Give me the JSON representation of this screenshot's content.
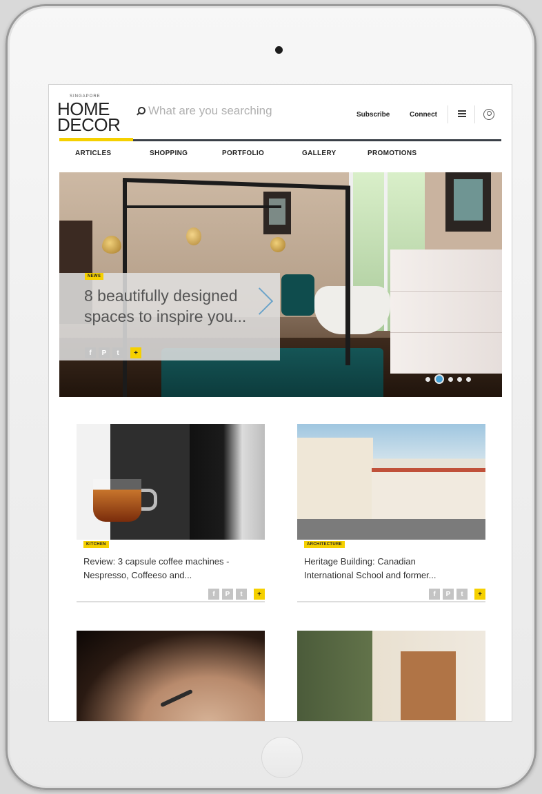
{
  "brand": {
    "logo_small": "SINGAPORE",
    "logo_line1": "HOME",
    "logo_line2": "DECOR"
  },
  "search": {
    "placeholder": "What are you searching"
  },
  "header": {
    "subscribe": "Subscribe",
    "connect": "Connect"
  },
  "nav": [
    "ARTICLES",
    "SHOPPING",
    "PORTFOLIO",
    "GALLERY",
    "PROMOTIONS"
  ],
  "hero": {
    "tag": "NEWS",
    "title_line1": "8 beautifully designed",
    "title_line2": "spaces to inspire you...",
    "slide_count": 5,
    "active_slide": 2
  },
  "share": {
    "facebook": "f",
    "pinterest": "P",
    "twitter": "t",
    "plus": "+"
  },
  "cards": [
    {
      "tag": "KITCHEN",
      "title_line1": "Review: 3 capsule coffee machines -",
      "title_line2": "Nespresso, Coffeeso and..."
    },
    {
      "tag": "ARCHITECTURE",
      "title_line1": "Heritage Building: Canadian",
      "title_line2": "International School and former..."
    }
  ],
  "colors": {
    "accent": "#f5d000",
    "nav_bar": "#3a3f47",
    "slide_active": "#45a1d6"
  }
}
